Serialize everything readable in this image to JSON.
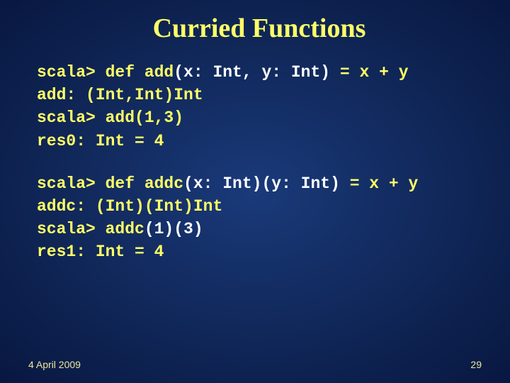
{
  "title": "Curried Functions",
  "block1": {
    "l1a": "scala> def add",
    "l1b": "(x: Int, y: Int)",
    "l1c": " = x + y",
    "l2": "add: (Int,Int)Int",
    "l3": "scala> add(1,3)",
    "l4": "res0: Int = 4"
  },
  "block2": {
    "l1a": "scala> def addc",
    "l1b": "(x: Int)(y: Int)",
    "l1c": " = x + y",
    "l2": "addc: (Int)(Int)Int",
    "l3a": "scala> addc",
    "l3b": "(1)(3)",
    "l4": "res1: Int = 4"
  },
  "footer": {
    "date": "4 April 2009",
    "page": "29"
  }
}
